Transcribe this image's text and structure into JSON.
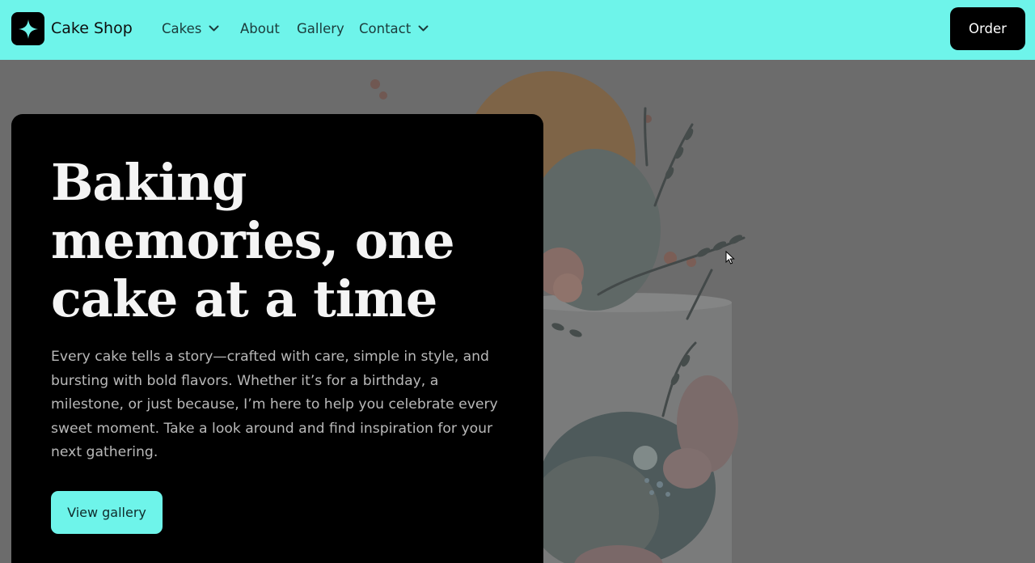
{
  "brand": {
    "name": "Cake Shop",
    "logo_icon": "sparkle-icon"
  },
  "nav": {
    "items": [
      {
        "label": "Cakes",
        "has_dropdown": true
      },
      {
        "label": "About",
        "has_dropdown": false
      },
      {
        "label": "Gallery",
        "has_dropdown": false
      },
      {
        "label": "Contact",
        "has_dropdown": true
      }
    ],
    "order_label": "Order"
  },
  "hero": {
    "headline": "Baking memories, one cake at a time",
    "body": "Every cake tells a story—crafted with care, simple in style, and bursting with bold flavors. Whether it’s for a birthday, a milestone, or just because, I’m here to help you celebrate every sweet moment. Take a look around and find inspiration for your next gathering.",
    "cta_label": "View gallery",
    "image_subject": "decorated-cake-illustration"
  },
  "colors": {
    "accent": "#6ef4ea",
    "card": "#000000",
    "overlay": "#6c6c6c"
  }
}
